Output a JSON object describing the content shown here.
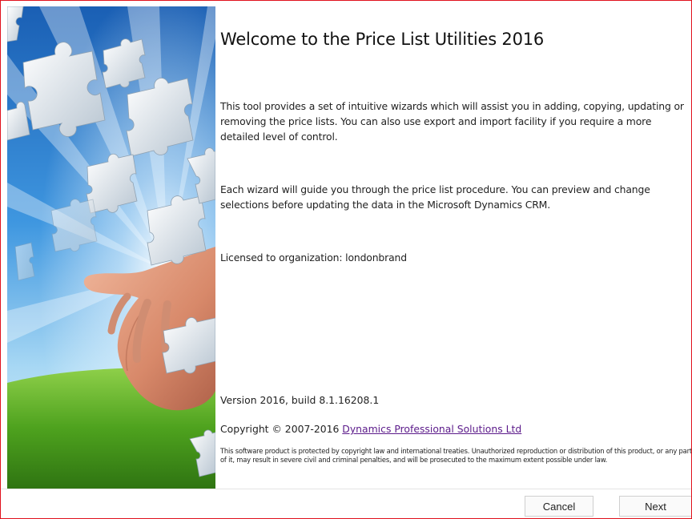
{
  "wizard": {
    "title": "Welcome to the Price List Utilities 2016",
    "intro": "This tool provides a set of intuitive wizards which will assist you in adding, copying, updating or removing the price lists. You can also use export and import facility if you require a more detailed level of control.",
    "guide": "Each wizard will guide you through the price list procedure. You can preview and change selections before updating the data in the Microsoft Dynamics CRM.",
    "license": "Licensed to organization: londonbrand",
    "version": "Version 2016, build 8.1.16208.1",
    "copyright_prefix": "Copyright © 2007-2016 ",
    "company_link": "Dynamics Professional Solutions Ltd",
    "legal": "This software product is protected by copyright law and international treaties. Unauthorized reproduction or distribution of this product, or any part of it, may result in severe civil and criminal penalties, and will be prosecuted to the maximum extent possible under law."
  },
  "buttons": {
    "cancel": "Cancel",
    "next": "Next"
  },
  "colors": {
    "frame_border": "#e0121c",
    "link": "#5b1a8a"
  },
  "hero": {
    "image": "hand-with-puzzle-pieces-sky"
  }
}
